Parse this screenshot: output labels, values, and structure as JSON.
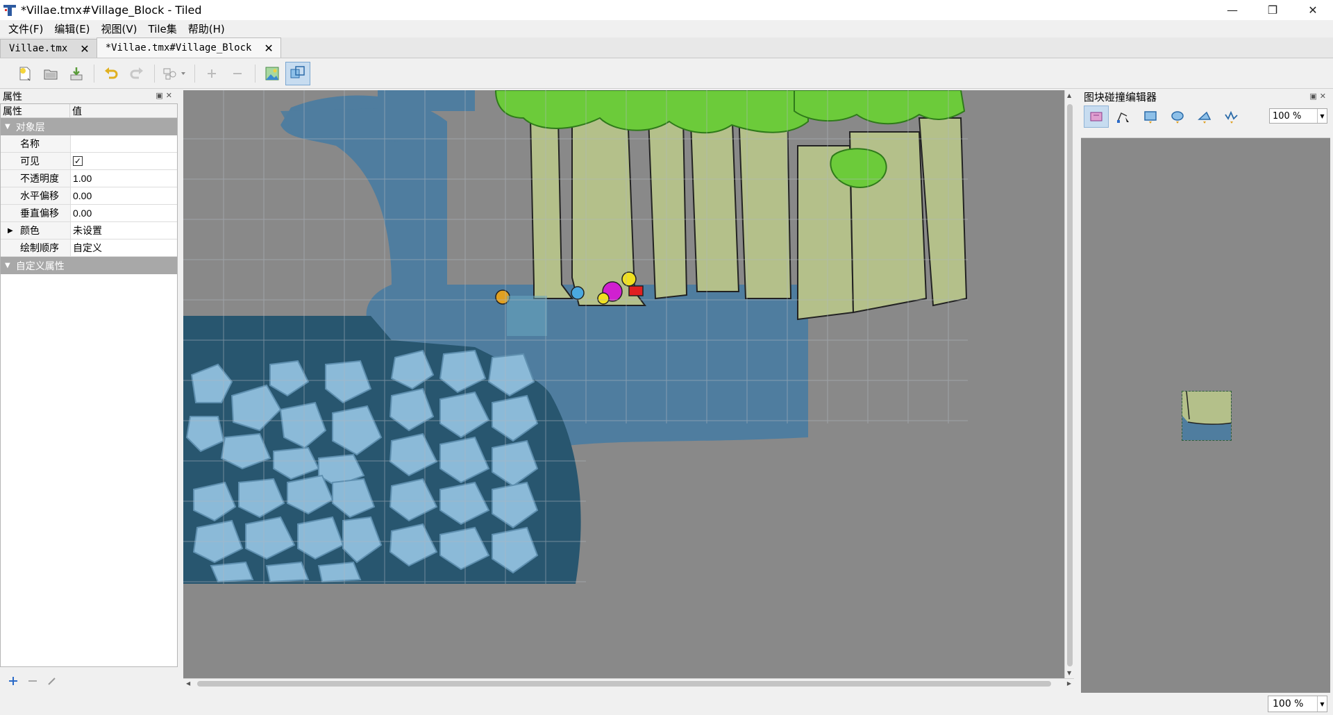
{
  "window": {
    "title": "*Villae.tmx#Village_Block - Tiled",
    "minimize": "—",
    "maximize": "❐",
    "close": "✕"
  },
  "menu": [
    "文件(F)",
    "编辑(E)",
    "视图(V)",
    "Tile集",
    "帮助(H)"
  ],
  "tabs": [
    {
      "label": "Villae.tmx",
      "active": false
    },
    {
      "label": "*Villae.tmx#Village_Block",
      "active": true
    }
  ],
  "properties": {
    "title": "属性",
    "col_name": "属性",
    "col_value": "值",
    "group_object_layer": "对象层",
    "rows": [
      {
        "key": "名称",
        "value": ""
      },
      {
        "key": "可见",
        "value": "✓"
      },
      {
        "key": "不透明度",
        "value": "1.00"
      },
      {
        "key": "水平偏移",
        "value": "0.00"
      },
      {
        "key": "垂直偏移",
        "value": "0.00"
      },
      {
        "key": "颜色",
        "value": "未设置"
      },
      {
        "key": "绘制顺序",
        "value": "自定义"
      }
    ],
    "group_custom": "自定义属性"
  },
  "collision_editor": {
    "title": "图块碰撞编辑器",
    "zoom": "100 %"
  },
  "status": {
    "zoom": "100 %"
  },
  "colors": {
    "canvas_bg": "#898989",
    "water": "#4f7d9f",
    "deep_water": "#28566f",
    "stone": "#8bbad8",
    "tree_trunk": "#b4c08a",
    "leaves": "#6ccb3a",
    "accent": "#c7dcf0"
  }
}
